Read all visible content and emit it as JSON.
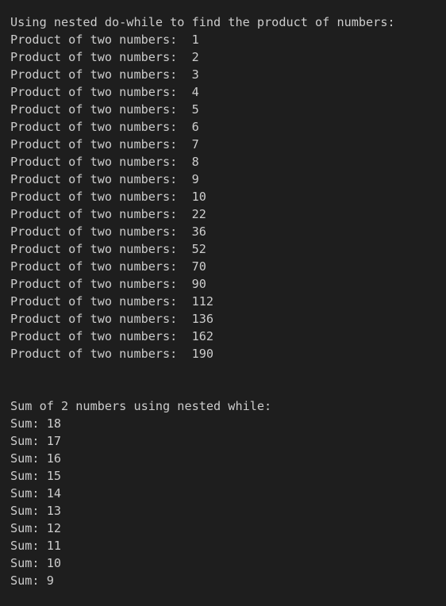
{
  "terminal": {
    "product_header": "Using nested do-while to find the product of numbers:",
    "product_lines": [
      "Product of two numbers:  1",
      "Product of two numbers:  2",
      "Product of two numbers:  3",
      "Product of two numbers:  4",
      "Product of two numbers:  5",
      "Product of two numbers:  6",
      "Product of two numbers:  7",
      "Product of two numbers:  8",
      "Product of two numbers:  9",
      "Product of two numbers:  10",
      "Product of two numbers:  22",
      "Product of two numbers:  36",
      "Product of two numbers:  52",
      "Product of two numbers:  70",
      "Product of two numbers:  90",
      "Product of two numbers:  112",
      "Product of two numbers:  136",
      "Product of two numbers:  162",
      "Product of two numbers:  190"
    ],
    "sum_header": "Sum of 2 numbers using nested while:",
    "sum_lines": [
      "Sum: 18",
      "Sum: 17",
      "Sum: 16",
      "Sum: 15",
      "Sum: 14",
      "Sum: 13",
      "Sum: 12",
      "Sum: 11",
      "Sum: 10",
      "Sum: 9"
    ]
  }
}
